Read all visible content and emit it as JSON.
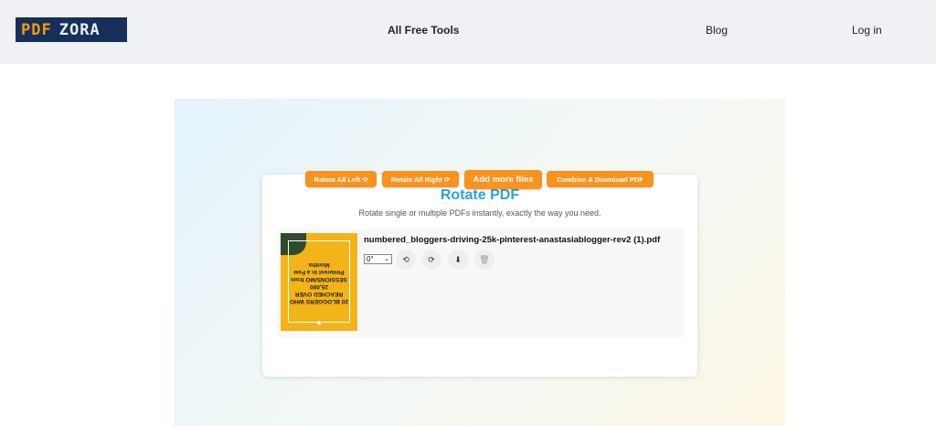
{
  "header": {
    "logo": {
      "part1": "PDF",
      "part2": "ZORA"
    },
    "nav": {
      "tools": "All Free Tools",
      "blog": "Blog",
      "login": "Log in"
    }
  },
  "tool": {
    "title": "Rotate PDF",
    "subtitle": "Rotate single or multiple PDFs instantly, exactly the way you need."
  },
  "file": {
    "name": "numbered_bloggers-driving-25k-pinterest-anastasiablogger-rev2 (1).pdf",
    "thumbnail_text": "20 BLOGGERS WHO REACHED OVER 25,000 SESSIONS/MO from Pinterest in a Few Months",
    "rotation": "0°",
    "actions": {
      "rotate_left": "⟲",
      "rotate_right": "⟳",
      "download": "⬇",
      "delete": "🗑"
    }
  },
  "buttons": {
    "rotate_all_left": "Rotate All Left ⟲",
    "rotate_all_right": "Rotate All Right ⟳",
    "add_more": "Add more files",
    "combine": "Combine & Download PDF"
  },
  "colors": {
    "accent_orange": "#f7931e",
    "title_blue": "#2f9fe0",
    "logo_bg": "#16305a"
  }
}
